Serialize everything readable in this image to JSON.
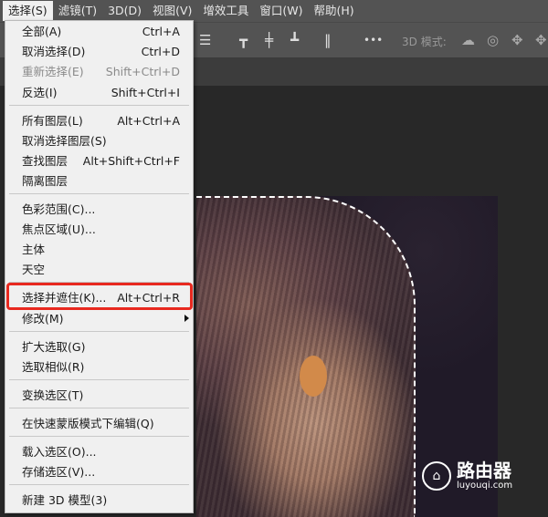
{
  "menubar": [
    "选择(S)",
    "滤镜(T)",
    "3D(D)",
    "视图(V)",
    "增效工具",
    "窗口(W)",
    "帮助(H)"
  ],
  "toolbar": {
    "mode_label": "3D 模式:",
    "more": "•••"
  },
  "menu": {
    "items": [
      {
        "label": "全部(A)",
        "shortcut": "Ctrl+A"
      },
      {
        "label": "取消选择(D)",
        "shortcut": "Ctrl+D"
      },
      {
        "label": "重新选择(E)",
        "shortcut": "Shift+Ctrl+D",
        "disabled": true
      },
      {
        "label": "反选(I)",
        "shortcut": "Shift+Ctrl+I"
      },
      {
        "label": "所有图层(L)",
        "shortcut": "Alt+Ctrl+A"
      },
      {
        "label": "取消选择图层(S)",
        "shortcut": ""
      },
      {
        "label": "查找图层",
        "shortcut": "Alt+Shift+Ctrl+F"
      },
      {
        "label": "隔离图层",
        "shortcut": ""
      },
      {
        "label": "色彩范围(C)...",
        "shortcut": ""
      },
      {
        "label": "焦点区域(U)...",
        "shortcut": ""
      },
      {
        "label": "主体",
        "shortcut": ""
      },
      {
        "label": "天空",
        "shortcut": ""
      },
      {
        "label": "选择并遮住(K)...",
        "shortcut": "Alt+Ctrl+R",
        "highlighted": true
      },
      {
        "label": "修改(M)",
        "shortcut": "",
        "submenu": true
      },
      {
        "label": "扩大选取(G)",
        "shortcut": ""
      },
      {
        "label": "选取相似(R)",
        "shortcut": ""
      },
      {
        "label": "变换选区(T)",
        "shortcut": ""
      },
      {
        "label": "在快速蒙版模式下编辑(Q)",
        "shortcut": ""
      },
      {
        "label": "载入选区(O)...",
        "shortcut": ""
      },
      {
        "label": "存储选区(V)...",
        "shortcut": ""
      },
      {
        "label": "新建 3D 模型(3)",
        "shortcut": ""
      }
    ]
  },
  "watermark": {
    "title": "路由器",
    "url": "luyouqi.com"
  },
  "colors": {
    "highlight": "#e8291f",
    "menu_bg": "#f0f0f0",
    "app_bg": "#535353"
  }
}
